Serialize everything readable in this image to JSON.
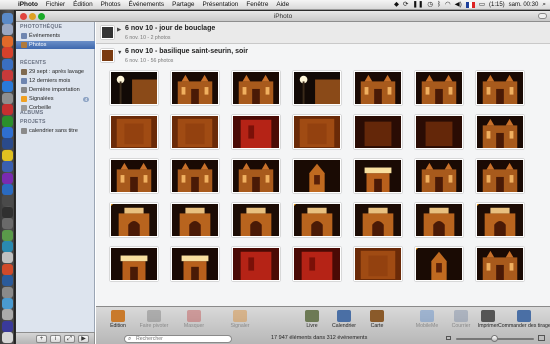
{
  "menubar": {
    "app_name": "iPhoto",
    "items": [
      "Fichier",
      "Édition",
      "Photos",
      "Événements",
      "Partage",
      "Présentation",
      "Fenêtre",
      "Aide"
    ],
    "battery": "(1:15)",
    "clock": "sam. 00:30"
  },
  "window": {
    "title": "iPhoto"
  },
  "sidebar": {
    "library_header": "PHOTOTHÈQUE",
    "library_items": [
      {
        "label": "Événements",
        "icon": "events-icon",
        "color": "#6f86b0"
      },
      {
        "label": "Photos",
        "icon": "photos-icon",
        "color": "#b07a3c",
        "selected": true
      }
    ],
    "recent_header": "RÉCENTS",
    "recent_items": [
      {
        "label": "29 sept : après lavage",
        "icon": "event-icon",
        "color": "#7f6a50"
      },
      {
        "label": "12 derniers mois",
        "icon": "calendar-icon",
        "color": "#6f86b0"
      },
      {
        "label": "Dernière importation",
        "icon": "import-icon",
        "color": "#888888"
      },
      {
        "label": "Signalées",
        "icon": "flag-icon",
        "color": "#f0a020",
        "badge": "4"
      },
      {
        "label": "Corbeille",
        "icon": "trash-icon",
        "color": "#999999"
      }
    ],
    "albums_header": "ALBUMS",
    "projects_header": "PROJETS",
    "project_items": [
      {
        "label": "calendrier sans titre",
        "icon": "calendar-project-icon",
        "color": "#8a8a8a"
      }
    ]
  },
  "events": [
    {
      "title": "6 nov 10 - jour de bouclage",
      "subtitle": "6 nov. 10 - 2 photos"
    },
    {
      "title": "6 nov 10 - basilique saint-seurin, soir",
      "subtitle": "6 nov. 10 - 56 photos"
    }
  ],
  "toolbar": {
    "tools": [
      {
        "label": "Édition",
        "icon": "pencil-icon",
        "enabled": true,
        "color": "#c97a2c"
      },
      {
        "label": "Faire pivoter",
        "icon": "rotate-icon",
        "enabled": false,
        "color": "#7a7a7a"
      },
      {
        "label": "Masquer",
        "icon": "hide-x-icon",
        "enabled": false,
        "color": "#c05050"
      },
      {
        "label": "Signaler",
        "icon": "flag-icon",
        "enabled": false,
        "color": "#d68a30"
      },
      {
        "label": "Livre",
        "icon": "book-icon",
        "enabled": true,
        "color": "#6d7a55"
      },
      {
        "label": "Calendrier",
        "icon": "calendar-icon",
        "enabled": true,
        "color": "#4a6fa5"
      },
      {
        "label": "Carte",
        "icon": "card-icon",
        "enabled": true,
        "color": "#8a5a2a"
      },
      {
        "label": "MobileMe",
        "icon": "mobileme-icon",
        "enabled": false,
        "color": "#5a8ac8"
      },
      {
        "label": "Courrier",
        "icon": "mail-icon",
        "enabled": false,
        "color": "#7a8aa5"
      },
      {
        "label": "Imprimer",
        "icon": "printer-icon",
        "enabled": true,
        "color": "#555555"
      },
      {
        "label": "Commander des tirages",
        "icon": "order-prints-icon",
        "enabled": true,
        "color": "#4a6fa5"
      }
    ],
    "search_placeholder": "Rechercher",
    "status": "17 947 éléments dans 312 événements",
    "zoom_level": 0.5
  },
  "photos": [
    [
      "street",
      "facade",
      "facade",
      "street",
      "facade",
      "facade",
      "facade"
    ],
    [
      "blur",
      "blur",
      "red",
      "blur",
      "dark",
      "dark",
      "facade"
    ],
    [
      "facade",
      "facade",
      "facade",
      "tower",
      "bright",
      "facade",
      "facade"
    ],
    [
      "arch",
      "arch",
      "arch",
      "arch",
      "arch",
      "arch",
      "arch"
    ],
    [
      "bright",
      "bright",
      "red",
      "red",
      "blur",
      "tower",
      "facade"
    ]
  ],
  "flagged_photos": [
    [
      3,
      0
    ],
    [
      3,
      3
    ],
    [
      3,
      6
    ],
    [
      4,
      5
    ]
  ]
}
